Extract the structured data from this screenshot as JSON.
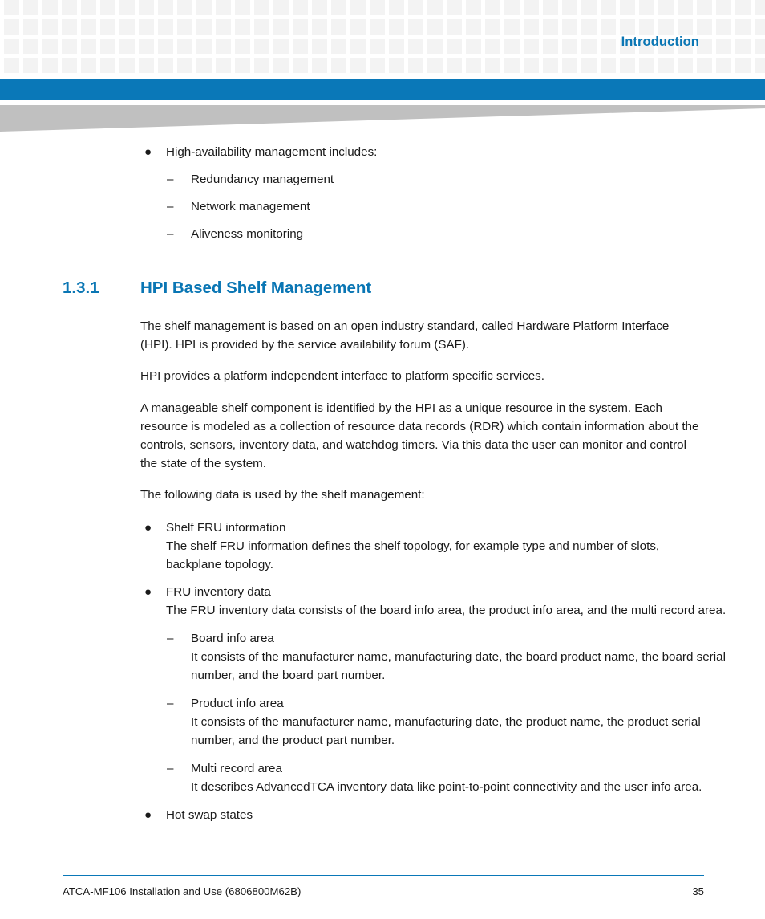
{
  "header": {
    "running_title": "Introduction",
    "accent_color": "#0a78b8",
    "heading_color": "#0a76b4",
    "grid_square_color": "#f3f3f3",
    "wedge_color": "#c0c0c0"
  },
  "intro_list": {
    "lead": {
      "marker": "●",
      "text": "High-availability management includes:"
    },
    "items": [
      {
        "marker": "–",
        "text": "Redundancy management"
      },
      {
        "marker": "–",
        "text": "Network management"
      },
      {
        "marker": "–",
        "text": "Aliveness monitoring"
      }
    ]
  },
  "section": {
    "number": "1.3.1",
    "title": "HPI Based Shelf Management"
  },
  "paragraphs": [
    "The shelf management is based on an open industry standard, called Hardware Platform Interface (HPI). HPI is provided by the service availability forum (SAF).",
    "HPI provides a platform independent interface to platform specific services.",
    "A manageable shelf component is identified by the HPI as a unique resource in the system. Each resource is modeled as a collection of resource data records (RDR) which contain information about the controls, sensors, inventory data, and watchdog timers. Via this data the user can monitor and control the state of the system.",
    "The following data is used by the shelf management:"
  ],
  "data_list": [
    {
      "marker": "●",
      "level": 1,
      "title": "Shelf FRU information",
      "body": "The shelf FRU information defines the shelf topology, for example type and number of slots, backplane topology."
    },
    {
      "marker": "●",
      "level": 1,
      "title": "FRU inventory data",
      "body": "The FRU inventory data consists of the board info area, the product info area, and the multi record area."
    },
    {
      "marker": "–",
      "level": 2,
      "title": "Board info area",
      "body": "It consists of the manufacturer name, manufacturing date, the board product name, the board serial number, and the board part number."
    },
    {
      "marker": "–",
      "level": 2,
      "title": "Product info area",
      "body": "It consists of the manufacturer name, manufacturing date, the product name, the product serial number, and the product part number."
    },
    {
      "marker": "–",
      "level": 2,
      "title": "Multi record area",
      "body": "It describes AdvancedTCA inventory data like point-to-point connectivity and the user info area."
    },
    {
      "marker": "●",
      "level": 1,
      "title": "Hot swap states",
      "body": ""
    }
  ],
  "footer": {
    "document_title": "ATCA-MF106 Installation and Use (6806800M62B)",
    "page_number": "35"
  }
}
